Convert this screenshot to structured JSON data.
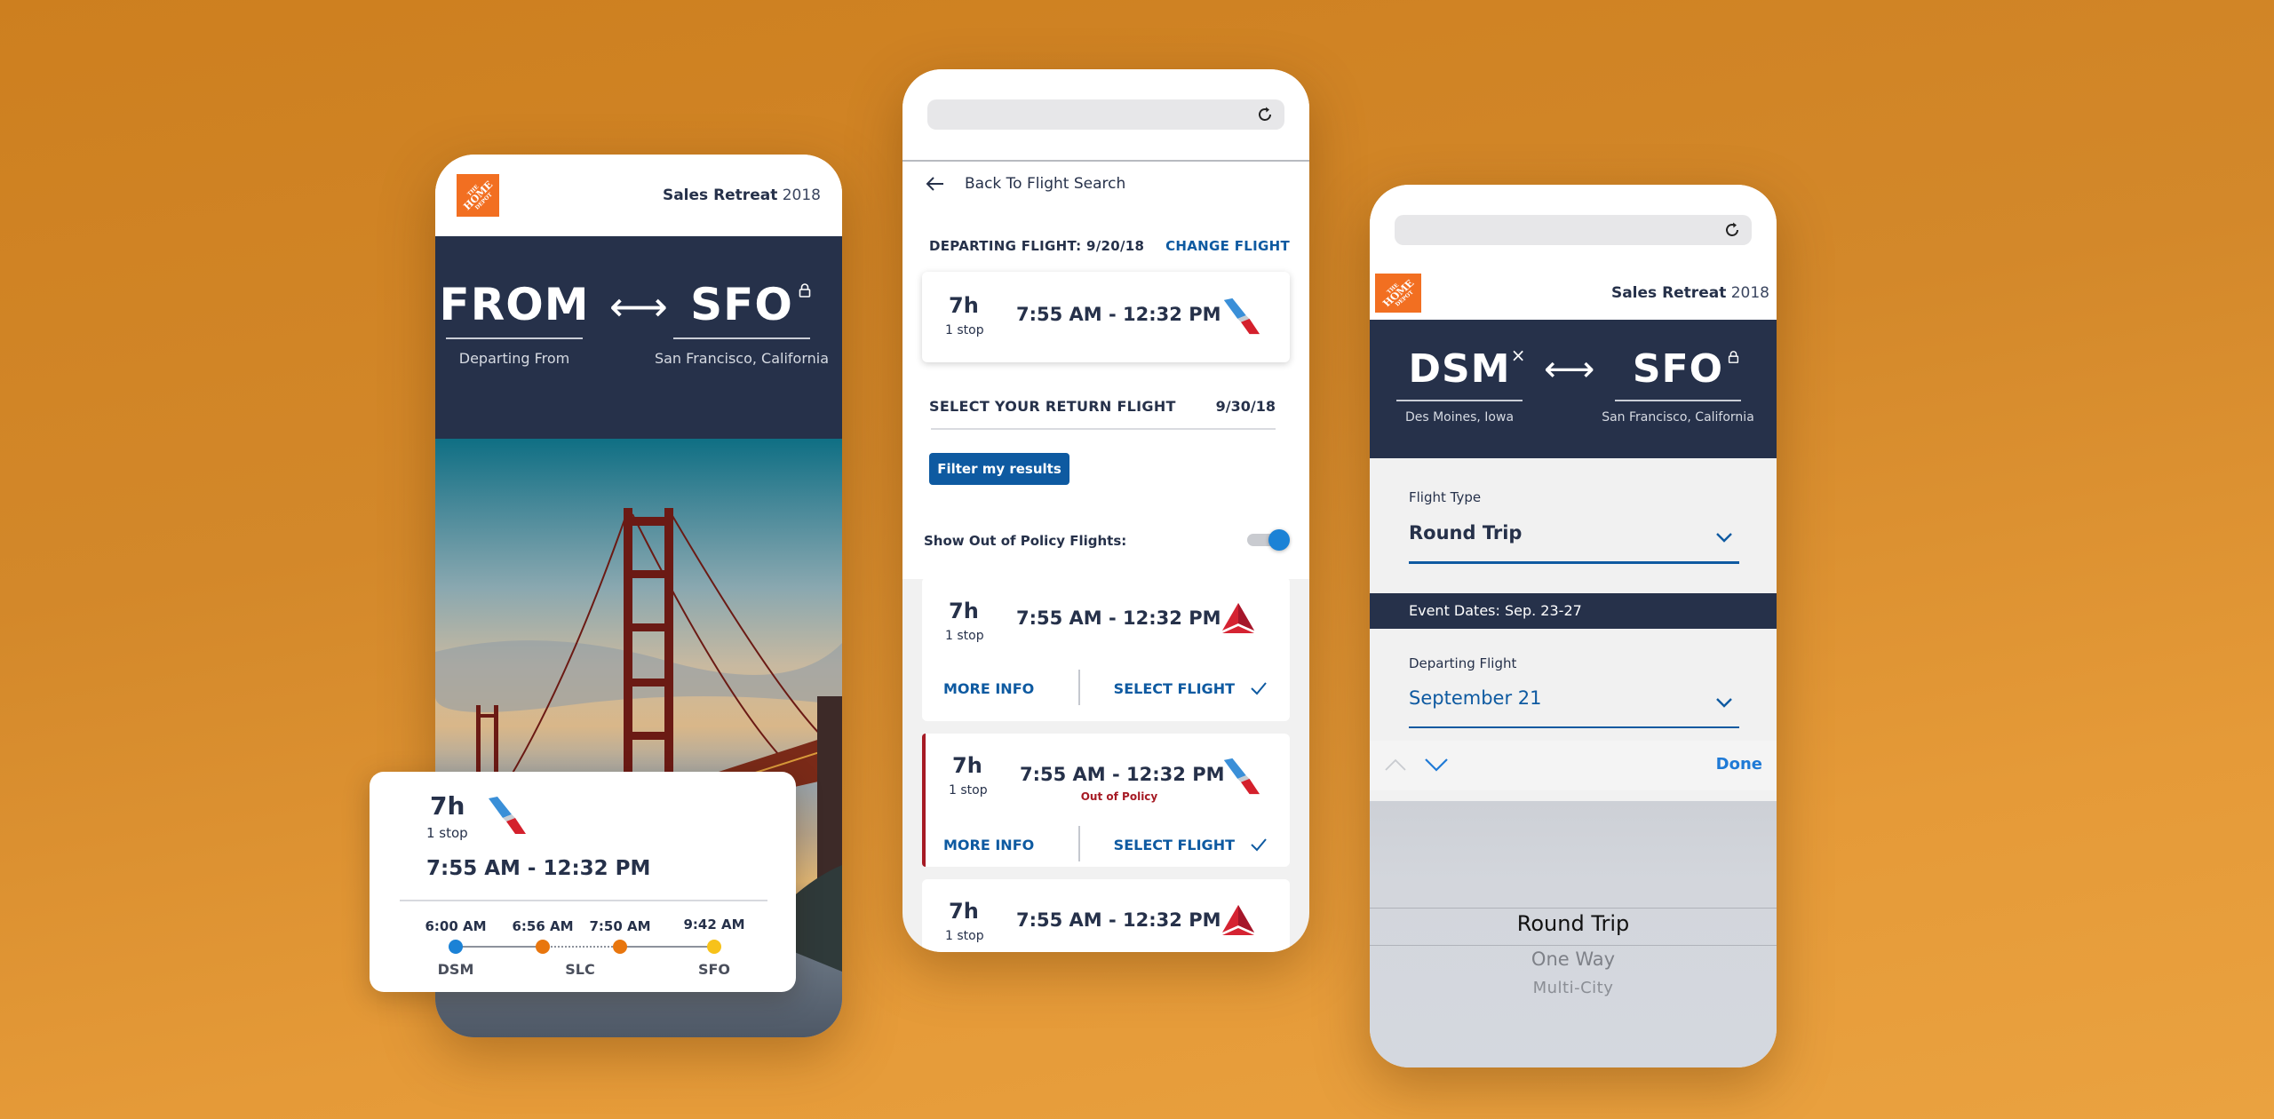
{
  "colors": {
    "navy": "#26314a",
    "brand_orange": "#f26f21",
    "link_blue": "#0e5aa1",
    "toggle_blue": "#1b82d6",
    "out_of_policy_red": "#a61a24",
    "origin_dot": "#1b82d6",
    "stop_dot": "#e8760e",
    "destination_dot": "#f7c21a"
  },
  "left_screen": {
    "header": {
      "logo": "home-depot-logo",
      "event_name": "Sales Retreat",
      "event_year": "2018"
    },
    "origin": {
      "code": "FROM",
      "subtitle": "Departing From"
    },
    "swap_icon": "⟷",
    "destination": {
      "code": "SFO",
      "subtitle": "San Francisco, California",
      "lock_icon": "lock-icon"
    },
    "flight_detail": {
      "duration": "7h",
      "stops": "1 stop",
      "airline": "american-airlines",
      "time_range": "7:55 AM  - 12:32 PM",
      "timeline": [
        {
          "time": "6:00 AM",
          "airport": "DSM",
          "type": "origin"
        },
        {
          "time": "6:56 AM",
          "airport": "",
          "type": "layover-arrive"
        },
        {
          "time": "7:50 AM",
          "airport": "SLC",
          "type": "layover-depart"
        },
        {
          "time": "9:42 AM",
          "airport": "SFO",
          "type": "destination"
        }
      ],
      "layover_label": "SLC"
    }
  },
  "middle_screen": {
    "back_link": "Back To Flight Search",
    "departing": {
      "label": "DEPARTING FLIGHT:",
      "date": "9/20/18",
      "change_label": "CHANGE FLIGHT"
    },
    "departing_flight": {
      "duration": "7h",
      "stops": "1 stop",
      "time_range": "7:55 AM  - 12:32 PM",
      "airline": "american-airlines"
    },
    "return": {
      "label": "SELECT YOUR RETURN FLIGHT",
      "date": "9/30/18"
    },
    "filter_button": "Filter my results",
    "toggle": {
      "label": "Show Out of Policy Flights:",
      "on": true
    },
    "results": [
      {
        "duration": "7h",
        "stops": "1 stop",
        "time_range": "7:55 AM  - 12:32 PM",
        "airline": "delta",
        "out_of_policy": false,
        "more_info": "MORE INFO",
        "select": "SELECT FLIGHT"
      },
      {
        "duration": "7h",
        "stops": "1 stop",
        "time_range": "7:55 AM  - 12:32 PM",
        "airline": "american-airlines",
        "out_of_policy": true,
        "policy_label": "Out of Policy",
        "more_info": "MORE INFO",
        "select": "SELECT FLIGHT"
      },
      {
        "duration": "7h",
        "stops": "1 stop",
        "time_range": "7:55 AM  - 12:32 PM",
        "airline": "delta",
        "out_of_policy": false
      }
    ]
  },
  "right_screen": {
    "header": {
      "event_name": "Sales Retreat",
      "event_year": "2018"
    },
    "origin": {
      "code": "DSM",
      "subtitle": "Des Moines, Iowa",
      "clear_icon": "×"
    },
    "swap_icon": "⟷",
    "destination": {
      "code": "SFO",
      "subtitle": "San Francisco, California"
    },
    "flight_type": {
      "label": "Flight Type",
      "value": "Round Trip"
    },
    "event_dates": "Event Dates: Sep. 23-27",
    "departing_flight": {
      "label": "Departing Flight",
      "value": "September 21"
    },
    "keyboard_bar": {
      "done": "Done"
    },
    "picker_options": [
      "Round Trip",
      "One Way",
      "Multi-City"
    ],
    "picker_selected": "Round Trip"
  }
}
